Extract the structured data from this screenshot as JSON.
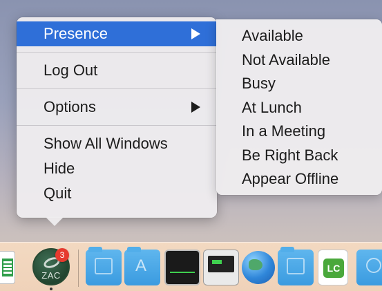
{
  "menu": {
    "items": [
      {
        "label": "Presence",
        "has_submenu": true,
        "selected": true
      },
      {
        "label": "Log Out",
        "has_submenu": false
      },
      {
        "label": "Options",
        "has_submenu": true
      },
      {
        "label": "Show All Windows",
        "has_submenu": false
      },
      {
        "label": "Hide",
        "has_submenu": false
      },
      {
        "label": "Quit",
        "has_submenu": false
      }
    ]
  },
  "submenu": {
    "items": [
      {
        "label": "Available"
      },
      {
        "label": "Not Available"
      },
      {
        "label": "Busy"
      },
      {
        "label": "At Lunch"
      },
      {
        "label": "In a Meeting"
      },
      {
        "label": "Be Right Back"
      },
      {
        "label": "Appear Offline"
      }
    ]
  },
  "dock": {
    "zac_badge_count": "3",
    "zac_label": "ZAC",
    "lc_label": "LC",
    "icons": [
      "numbers-icon",
      "zac-app-icon",
      "folder-icon",
      "applications-folder-icon",
      "activity-monitor-icon",
      "console-icon",
      "globe-icon",
      "document-folder-icon",
      "lc-app-icon",
      "downloads-folder-icon"
    ]
  },
  "colors": {
    "selection": "#2f6fd8",
    "menu_bg": "#eeecee",
    "dock_bg": "#f0d4bb",
    "badge": "#e63a2e",
    "folder_blue": "#3a9be0"
  }
}
